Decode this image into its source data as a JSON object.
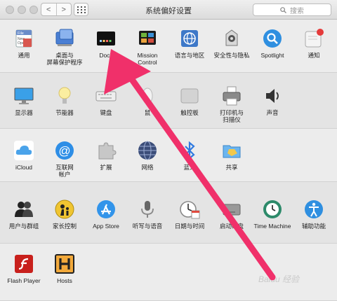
{
  "window": {
    "title": "系统偏好设置",
    "search_placeholder": "搜索",
    "nav_back": "<",
    "nav_forward": ">"
  },
  "rows": [
    {
      "items": [
        {
          "label": "通用",
          "icon": "general-icon"
        },
        {
          "label": "桌面与\n屏幕保护程序",
          "icon": "desktop-screensaver-icon"
        },
        {
          "label": "Dock",
          "icon": "dock-icon"
        },
        {
          "label": "Mission\nControl",
          "icon": "mission-control-icon"
        },
        {
          "label": "语言与地区",
          "icon": "language-region-icon"
        },
        {
          "label": "安全性与隐私",
          "icon": "security-privacy-icon"
        },
        {
          "label": "Spotlight",
          "icon": "spotlight-icon"
        },
        {
          "label": "通知",
          "icon": "notifications-icon"
        }
      ]
    },
    {
      "items": [
        {
          "label": "显示器",
          "icon": "displays-icon"
        },
        {
          "label": "节能器",
          "icon": "energy-saver-icon"
        },
        {
          "label": "键盘",
          "icon": "keyboard-icon"
        },
        {
          "label": "鼠",
          "icon": "mouse-icon"
        },
        {
          "label": "触控板",
          "icon": "trackpad-icon"
        },
        {
          "label": "打印机与\n扫描仪",
          "icon": "printers-scanners-icon"
        },
        {
          "label": "声音",
          "icon": "sound-icon"
        }
      ]
    },
    {
      "items": [
        {
          "label": "iCloud",
          "icon": "icloud-icon"
        },
        {
          "label": "互联网\n帐户",
          "icon": "internet-accounts-icon"
        },
        {
          "label": "扩展",
          "icon": "extensions-icon"
        },
        {
          "label": "网络",
          "icon": "network-icon"
        },
        {
          "label": "蓝牙",
          "icon": "bluetooth-icon"
        },
        {
          "label": "共享",
          "icon": "sharing-icon"
        }
      ]
    },
    {
      "items": [
        {
          "label": "用户与群组",
          "icon": "users-groups-icon"
        },
        {
          "label": "家长控制",
          "icon": "parental-controls-icon"
        },
        {
          "label": "App Store",
          "icon": "app-store-icon"
        },
        {
          "label": "听写与语音",
          "icon": "dictation-speech-icon"
        },
        {
          "label": "日期与时间",
          "icon": "date-time-icon"
        },
        {
          "label": "启动磁盘",
          "icon": "startup-disk-icon"
        },
        {
          "label": "Time Machine",
          "icon": "time-machine-icon"
        },
        {
          "label": "辅助功能",
          "icon": "accessibility-icon"
        }
      ]
    },
    {
      "items": [
        {
          "label": "Flash Player",
          "icon": "flash-player-icon"
        },
        {
          "label": "Hosts",
          "icon": "hosts-icon"
        }
      ]
    }
  ],
  "watermark": "Baidu 经验",
  "annotation": {
    "color": "#f0306a"
  }
}
